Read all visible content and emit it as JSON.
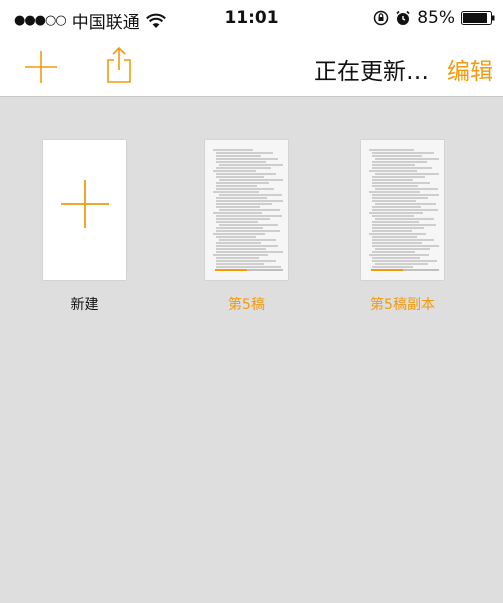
{
  "colors": {
    "accent": "#f39a0e",
    "background": "#dedede"
  },
  "status_bar": {
    "signal": "●●●○○",
    "carrier": "中国联通",
    "time": "11:01",
    "battery": "85%",
    "icons": [
      "signal-dots-icon",
      "wifi-icon",
      "orientation-lock-icon",
      "alarm-icon",
      "battery-icon"
    ]
  },
  "nav": {
    "status_text": "正在更新…",
    "edit_label": "编辑",
    "icons": [
      "plus-icon",
      "share-icon"
    ]
  },
  "documents": [
    {
      "label": "新建",
      "kind": "new",
      "label_color": "black"
    },
    {
      "label": "第5稿",
      "kind": "document",
      "label_color": "orange"
    },
    {
      "label": "第5稿副本",
      "kind": "document",
      "label_color": "orange"
    }
  ]
}
